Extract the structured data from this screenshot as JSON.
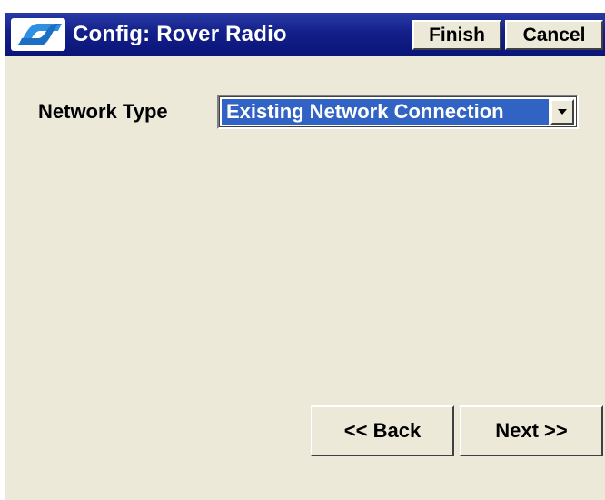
{
  "window": {
    "title": "Config: Rover Radio",
    "finish_label": "Finish",
    "cancel_label": "Cancel",
    "logo_icon": "app-logo-icon"
  },
  "form": {
    "network_type_label": "Network Type",
    "network_type_value": "Existing Network Connection",
    "dropdown_icon": "chevron-down-icon"
  },
  "navigation": {
    "back_label": "<< Back",
    "next_label": "Next >>"
  },
  "colors": {
    "title_bar": "#13208A",
    "background": "#ECE9D8",
    "selection": "#3163C5",
    "logo_blue": "#2F8FE0"
  }
}
